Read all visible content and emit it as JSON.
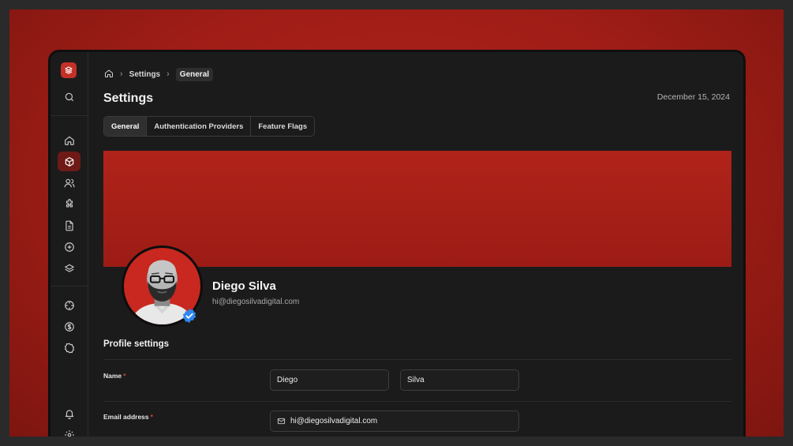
{
  "breadcrumb": {
    "items": [
      "Settings"
    ],
    "current": "General"
  },
  "header": {
    "title": "Settings",
    "date": "December 15, 2024"
  },
  "tabs": [
    {
      "label": "General",
      "active": true
    },
    {
      "label": "Authentication Providers",
      "active": false
    },
    {
      "label": "Feature Flags",
      "active": false
    }
  ],
  "profile": {
    "name": "Diego Silva",
    "email": "hi@diegosilvadigital.com",
    "verified": true
  },
  "form": {
    "section_title": "Profile settings",
    "name_label": "Name",
    "first_name": "Diego",
    "last_name": "Silva",
    "email_label": "Email address",
    "email_value": "hi@diegosilvadigital.com",
    "required_mark": "*"
  },
  "sidebar": {
    "icons": [
      "logo",
      "search-icon",
      "home-icon",
      "box-icon",
      "users-icon",
      "puzzle-icon",
      "document-icon",
      "add-circle-icon",
      "layers-icon",
      "crosshair-icon",
      "dollar-icon",
      "badge-icon",
      "bell-icon",
      "settings-icon"
    ],
    "active": "box-icon"
  },
  "colors": {
    "accent": "#c43128",
    "background": "#1b1b1b",
    "backdrop": "#a8211a",
    "verified": "#2f86f0"
  }
}
